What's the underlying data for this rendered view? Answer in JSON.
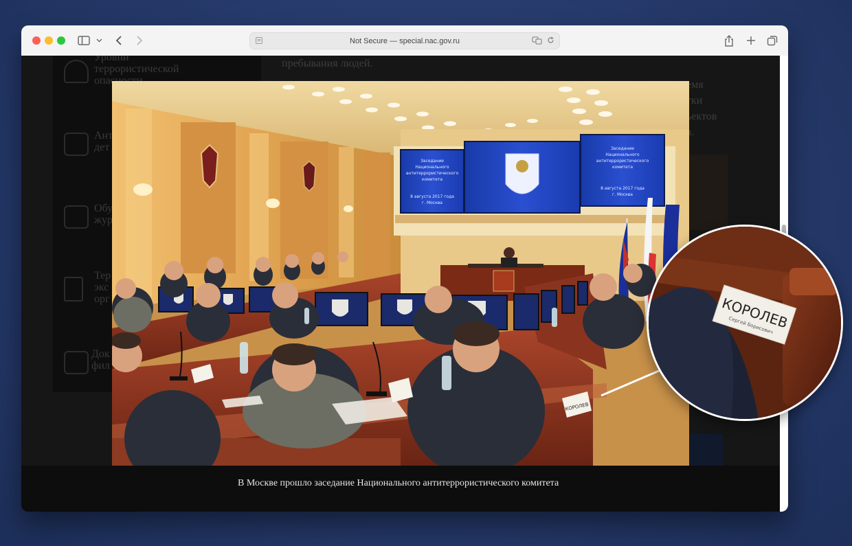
{
  "browser": {
    "address_text": "Not Secure — special.nac.gov.ru"
  },
  "sidebar": {
    "items": [
      {
        "label": "Уровни\nтеррористической\nопасности",
        "icon": "gauge-icon"
      },
      {
        "label": "Ант\nдет",
        "icon": "people-icon"
      },
      {
        "label": "Обу\nжур",
        "icon": "camera-icon"
      },
      {
        "label": "Тер\nэкс\nорг",
        "icon": "list-icon"
      },
      {
        "label": "Док\nфил",
        "icon": "film-icon"
      }
    ]
  },
  "article": {
    "line1": "пребывания людей.",
    "right_fragments": [
      "емя",
      "тки",
      "ьектов",
      "а."
    ]
  },
  "photo": {
    "screen_left_text": "Заседание Национального антитеррористического комитета 8 августа 2017 года г. Москва",
    "screen_right_text": "Заседание Национального антитеррористического комитета 8 августа 2017 года г. Москва",
    "nameplate_text": "КОРОЛЕВ",
    "nameplate_subtext": "Сергей Борисович",
    "caption": "В Москве прошло заседание Национального антитеррористического комитета"
  },
  "colors": {
    "background": "#263a6b",
    "page_dark": "#161616",
    "wall": "#e7b05e",
    "desk": "#8e2f1b",
    "screen": "#1b3fb4"
  }
}
